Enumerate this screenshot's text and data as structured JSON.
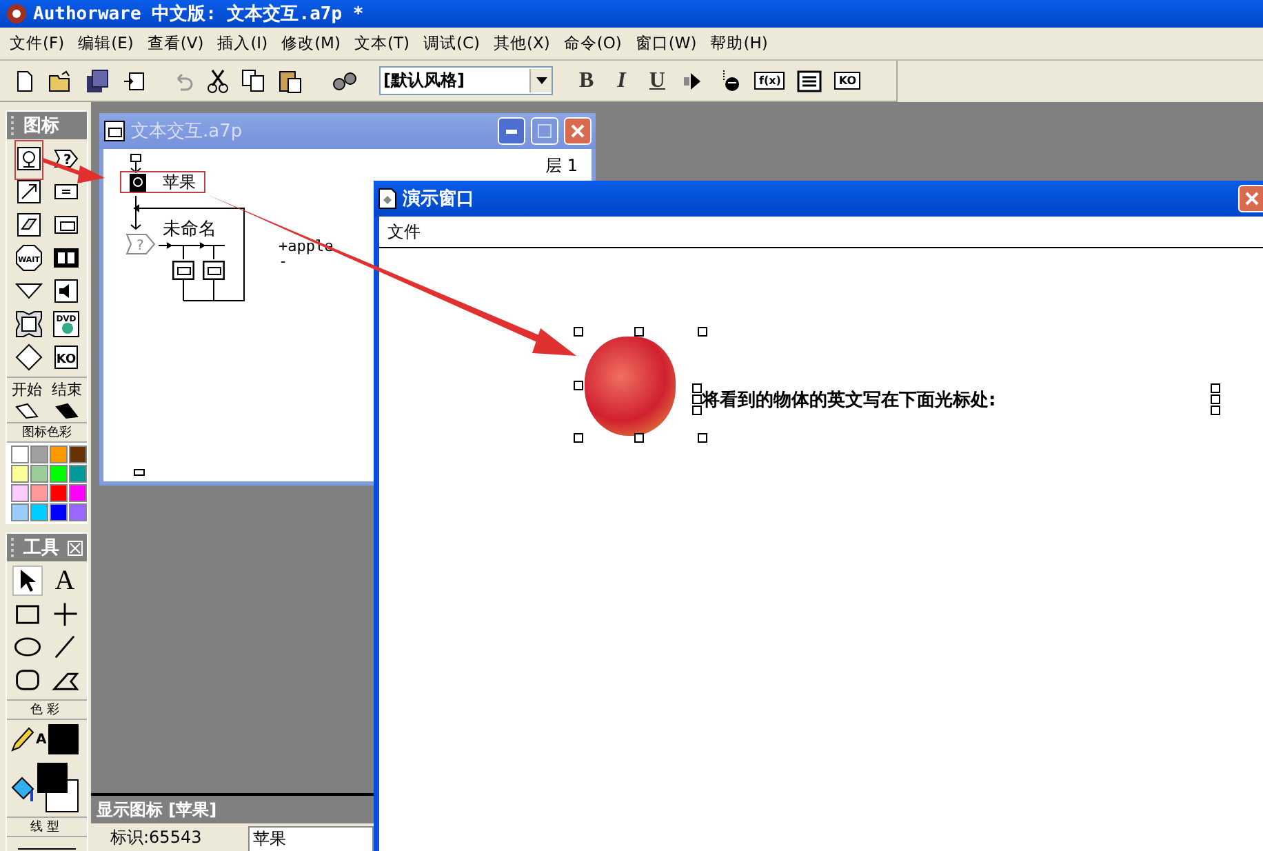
{
  "window": {
    "title": "Authorware 中文版: 文本交互.a7p *"
  },
  "menu": [
    "文件(F)",
    "编辑(E)",
    "查看(V)",
    "插入(I)",
    "修改(M)",
    "文本(T)",
    "调试(C)",
    "其他(X)",
    "命令(O)",
    "窗口(W)",
    "帮助(H)"
  ],
  "toolbar": [
    {
      "kind": "new"
    },
    {
      "kind": "open"
    },
    {
      "kind": "save-all"
    },
    {
      "kind": "import"
    },
    {
      "kind": "sep"
    },
    {
      "kind": "undo"
    },
    {
      "kind": "cut"
    },
    {
      "kind": "copy"
    },
    {
      "kind": "paste"
    },
    {
      "kind": "sep"
    },
    {
      "kind": "find"
    },
    {
      "kind": "select",
      "value": "[默认风格]"
    },
    {
      "kind": "letter",
      "label": "B"
    },
    {
      "kind": "letter",
      "label": "I"
    },
    {
      "kind": "letter",
      "label": "U"
    },
    {
      "kind": "play"
    },
    {
      "kind": "control"
    },
    {
      "kind": "boxed",
      "label": "f(x)"
    },
    {
      "kind": "list"
    },
    {
      "kind": "boxed",
      "label": "KO"
    }
  ],
  "icon_palette": {
    "title": "图标",
    "icons": [
      {
        "kind": "display"
      },
      {
        "kind": "interaction",
        "label": "?"
      },
      {
        "kind": "motion"
      },
      {
        "kind": "calculation"
      },
      {
        "kind": "erase"
      },
      {
        "kind": "digital-movie"
      },
      {
        "kind": "wait",
        "label": "WAIT"
      },
      {
        "kind": "movie"
      },
      {
        "kind": "navigate"
      },
      {
        "kind": "sound"
      },
      {
        "kind": "framework"
      },
      {
        "kind": "dvd",
        "label": "DVD"
      },
      {
        "kind": "decision"
      },
      {
        "kind": "knowledge",
        "label": "KO"
      }
    ],
    "start_label": "开始",
    "end_label": "结束",
    "colors_title": "图标色彩",
    "colors": [
      {
        "color": "#ffffff"
      },
      {
        "color": "#a0a0a0"
      },
      {
        "color": "#ff9900"
      },
      {
        "color": "#663300"
      },
      {
        "color": "#ffff99"
      },
      {
        "color": "#99cc99"
      },
      {
        "color": "#00ff00"
      },
      {
        "color": "#009999"
      },
      {
        "color": "#ffccff"
      },
      {
        "color": "#ff9999"
      },
      {
        "color": "#ff0000"
      },
      {
        "color": "#ff00ff"
      },
      {
        "color": "#99ccff"
      },
      {
        "color": "#00ccff"
      },
      {
        "color": "#0000ff"
      },
      {
        "color": "#9966ff"
      }
    ]
  },
  "tools_palette": {
    "title": "工具",
    "tools": [
      {
        "kind": "pointer",
        "selected": true
      },
      {
        "kind": "text",
        "label": "A",
        "selected": false
      },
      {
        "kind": "rectangle",
        "selected": false
      },
      {
        "kind": "cross",
        "selected": false
      },
      {
        "kind": "ellipse",
        "selected": false
      },
      {
        "kind": "line",
        "selected": false
      },
      {
        "kind": "rounded-rectangle",
        "selected": false
      },
      {
        "kind": "polygon",
        "selected": false
      }
    ],
    "color_title": "色彩",
    "text_color_label": "A",
    "line_title": "线型"
  },
  "flow_window": {
    "title": "文本交互.a7p",
    "level": "层 1",
    "display_icon_name": "苹果",
    "interaction_name": "未命名",
    "interaction_label": "?",
    "responses": [
      "+apple",
      "-"
    ]
  },
  "presentation": {
    "title": "演示窗口",
    "menu": [
      "文件"
    ],
    "prompt": "将看到的物体的英文写在下面光标处:"
  },
  "properties": {
    "title": "显示图标 [苹果]",
    "id_label": "标识:65543",
    "name_value": "苹果"
  }
}
